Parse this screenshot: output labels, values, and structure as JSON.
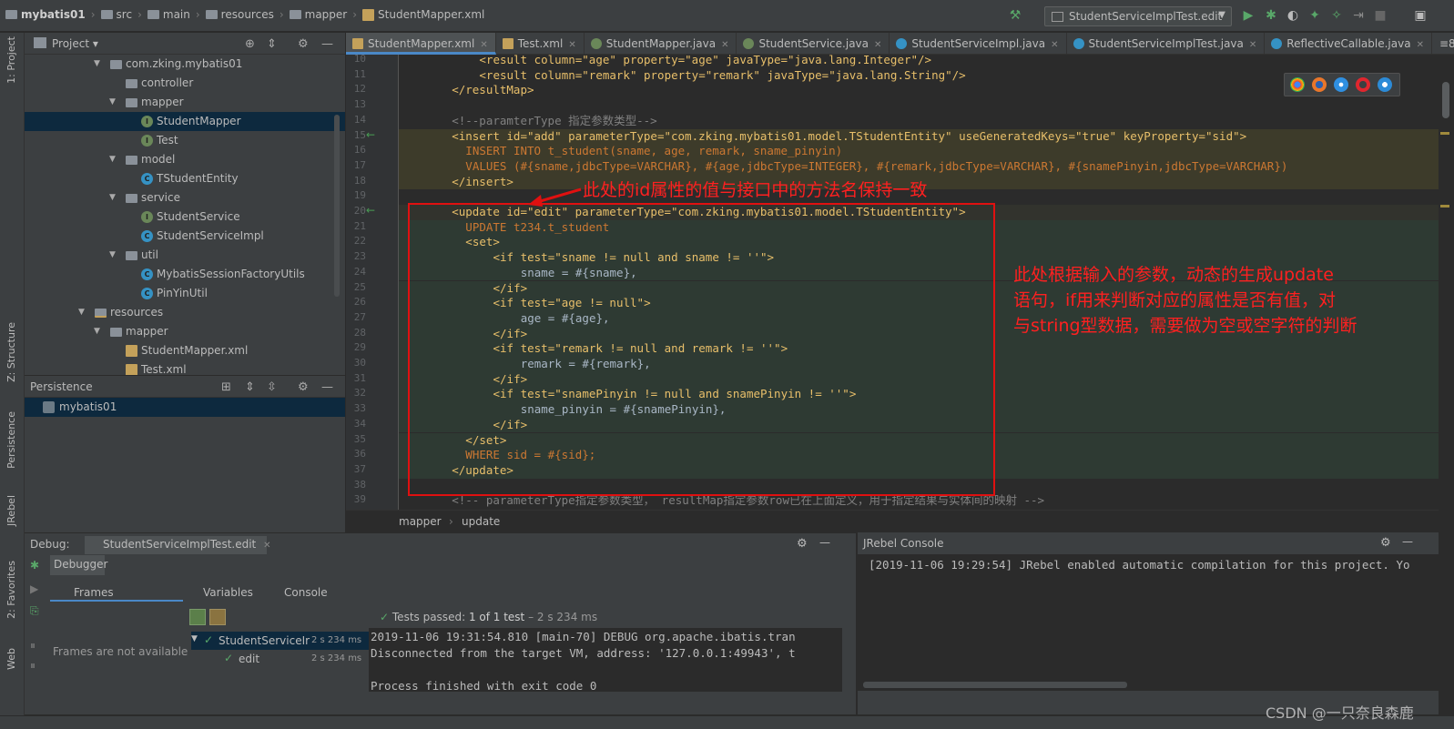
{
  "navbar": {
    "crumbs": [
      "mybatis01",
      "src",
      "main",
      "resources",
      "mapper",
      "StudentMapper.xml"
    ],
    "run_config": "StudentServiceImplTest.edit"
  },
  "left_strip": {
    "tabs": [
      "1: Project",
      "Z: Structure",
      "Persistence",
      "JRebel",
      "2: Favorites",
      "Web"
    ]
  },
  "project_panel": {
    "title": "Project",
    "tree": [
      {
        "label": "com.zking.mybatis01",
        "icon": "folder-icon",
        "depth": 0,
        "arrow": "▼"
      },
      {
        "label": "controller",
        "icon": "folder-icon",
        "depth": 1,
        "arrow": ""
      },
      {
        "label": "mapper",
        "icon": "folder-icon",
        "depth": 1,
        "arrow": "▼"
      },
      {
        "label": "StudentMapper",
        "icon": "interface-icon",
        "depth": 2,
        "arrow": "",
        "selected": true
      },
      {
        "label": "Test",
        "icon": "interface-icon",
        "depth": 2,
        "arrow": ""
      },
      {
        "label": "model",
        "icon": "folder-icon",
        "depth": 1,
        "arrow": "▼"
      },
      {
        "label": "TStudentEntity",
        "icon": "class-icon",
        "depth": 2,
        "arrow": ""
      },
      {
        "label": "service",
        "icon": "folder-icon",
        "depth": 1,
        "arrow": "▼"
      },
      {
        "label": "StudentService",
        "icon": "interface-icon",
        "depth": 2,
        "arrow": ""
      },
      {
        "label": "StudentServiceImpl",
        "icon": "class-icon",
        "depth": 2,
        "arrow": ""
      },
      {
        "label": "util",
        "icon": "folder-icon",
        "depth": 1,
        "arrow": "▼"
      },
      {
        "label": "MybatisSessionFactoryUtils",
        "icon": "class-icon",
        "depth": 2,
        "arrow": ""
      },
      {
        "label": "PinYinUtil",
        "icon": "class-icon",
        "depth": 2,
        "arrow": ""
      },
      {
        "label": "resources",
        "icon": "resources-folder-icon",
        "depth": -1,
        "arrow": "▼"
      },
      {
        "label": "mapper",
        "icon": "folder-icon",
        "depth": 0,
        "arrow": "▼"
      },
      {
        "label": "StudentMapper.xml",
        "icon": "xml-icon",
        "depth": 1,
        "arrow": ""
      },
      {
        "label": "Test.xml",
        "icon": "xml-icon",
        "depth": 1,
        "arrow": ""
      }
    ]
  },
  "persistence_panel": {
    "title": "Persistence",
    "item": "mybatis01"
  },
  "editor": {
    "tabs": [
      {
        "label": "StudentMapper.xml",
        "icon": "xml",
        "active": true
      },
      {
        "label": "Test.xml",
        "icon": "xml",
        "active": false
      },
      {
        "label": "StudentMapper.java",
        "icon": "iface",
        "active": false
      },
      {
        "label": "StudentService.java",
        "icon": "iface",
        "active": false
      },
      {
        "label": "StudentServiceImpl.java",
        "icon": "cls",
        "active": false
      },
      {
        "label": "StudentServiceImplTest.java",
        "icon": "cls",
        "active": false
      },
      {
        "label": "ReflectiveCallable.java",
        "icon": "cls",
        "active": false
      }
    ],
    "overflow": "≡8",
    "lines": [
      {
        "n": "10",
        "indent": 8,
        "text": "<result column=\"age\" property=\"age\" javaType=\"java.lang.Integer\"/>",
        "cls": "tag",
        "hl": ""
      },
      {
        "n": "11",
        "indent": 8,
        "text": "<result column=\"remark\" property=\"remark\" javaType=\"java.lang.String\"/>",
        "cls": "tag",
        "hl": ""
      },
      {
        "n": "12",
        "indent": 4,
        "text": "</resultMap>",
        "cls": "tag",
        "hl": ""
      },
      {
        "n": "13",
        "indent": 0,
        "text": "",
        "cls": "plain",
        "hl": ""
      },
      {
        "n": "14",
        "indent": 4,
        "text": "<!--paramterType 指定参数类型-->",
        "cls": "cmt",
        "hl": ""
      },
      {
        "n": "15",
        "indent": 4,
        "text": "<insert id=\"add\" parameterType=\"com.zking.mybatis01.model.TStudentEntity\" useGeneratedKeys=\"true\" keyProperty=\"sid\">",
        "cls": "tag",
        "hl": "insert",
        "mark": "←"
      },
      {
        "n": "16",
        "indent": 6,
        "text": "INSERT INTO t_student(sname, age, remark, sname_pinyin)",
        "cls": "sqlk",
        "hl": "insert"
      },
      {
        "n": "17",
        "indent": 6,
        "text": "VALUES (#{sname,jdbcType=VARCHAR}, #{age,jdbcType=INTEGER}, #{remark,jdbcType=VARCHAR}, #{snamePinyin,jdbcType=VARCHAR})",
        "cls": "sqlk",
        "hl": "insert"
      },
      {
        "n": "18",
        "indent": 4,
        "text": "</insert>",
        "cls": "tag",
        "hl": "insert"
      },
      {
        "n": "19",
        "indent": 0,
        "text": "",
        "cls": "plain",
        "hl": ""
      },
      {
        "n": "20",
        "indent": 4,
        "text": "<update id=\"edit\" parameterType=\"com.zking.mybatis01.model.TStudentEntity\">",
        "cls": "tag",
        "hl": "current",
        "mark": "←"
      },
      {
        "n": "21",
        "indent": 6,
        "text": "UPDATE t234.t_student",
        "cls": "sqlk",
        "hl": "update"
      },
      {
        "n": "22",
        "indent": 6,
        "text": "<set>",
        "cls": "tag",
        "hl": "update"
      },
      {
        "n": "23",
        "indent": 10,
        "text": "<if test=\"sname != null and sname != ''\">",
        "cls": "tag",
        "hl": "update"
      },
      {
        "n": "24",
        "indent": 14,
        "text": "sname = #{sname},",
        "cls": "plain",
        "hl": "update"
      },
      {
        "n": "25",
        "indent": 10,
        "text": "</if>",
        "cls": "tag",
        "hl": "update"
      },
      {
        "n": "26",
        "indent": 10,
        "text": "<if test=\"age != null\">",
        "cls": "tag",
        "hl": "update"
      },
      {
        "n": "27",
        "indent": 14,
        "text": "age = #{age},",
        "cls": "plain",
        "hl": "update"
      },
      {
        "n": "28",
        "indent": 10,
        "text": "</if>",
        "cls": "tag",
        "hl": "update"
      },
      {
        "n": "29",
        "indent": 10,
        "text": "<if test=\"remark != null and remark != ''\">",
        "cls": "tag",
        "hl": "update"
      },
      {
        "n": "30",
        "indent": 14,
        "text": "remark = #{remark},",
        "cls": "plain",
        "hl": "update"
      },
      {
        "n": "31",
        "indent": 10,
        "text": "</if>",
        "cls": "tag",
        "hl": "update"
      },
      {
        "n": "32",
        "indent": 10,
        "text": "<if test=\"snamePinyin != null and snamePinyin != ''\">",
        "cls": "tag",
        "hl": "update"
      },
      {
        "n": "33",
        "indent": 14,
        "text": "sname_pinyin = #{snamePinyin},",
        "cls": "plain",
        "hl": "update"
      },
      {
        "n": "34",
        "indent": 10,
        "text": "</if>",
        "cls": "tag",
        "hl": "update"
      },
      {
        "n": "35",
        "indent": 6,
        "text": "</set>",
        "cls": "tag",
        "hl": "update"
      },
      {
        "n": "36",
        "indent": 6,
        "text": "WHERE sid = #{sid};",
        "cls": "sqlk",
        "hl": "update"
      },
      {
        "n": "37",
        "indent": 4,
        "text": "</update>",
        "cls": "tag",
        "hl": "update"
      },
      {
        "n": "38",
        "indent": 0,
        "text": "",
        "cls": "plain",
        "hl": ""
      },
      {
        "n": "39",
        "indent": 4,
        "text": "<!-- parameterType指定参数类型， resultMap指定参数row已在上面定义，用于指定结果与实体间的映射 -->",
        "cls": "cmt",
        "hl": ""
      }
    ],
    "breadcrumb": [
      "mapper",
      "update"
    ]
  },
  "annotations": {
    "top": "此处的id属性的值与接口中的方法名保持一致",
    "side": [
      "此处根据输入的参数，动态的生成update",
      "语句，if用来判断对应的属性是否有值，对",
      "与string型数据，需要做为空或空字符的判断"
    ]
  },
  "debug_panel": {
    "title": "Debug:",
    "config_tab": "StudentServiceImplTest.edit",
    "debugger_tab": "Debugger",
    "frames_tab": "Frames",
    "variables_tab": "Variables",
    "console_tab": "Console",
    "frames_empty": "Frames are not available",
    "tests_passed": "Tests passed:",
    "tests_count": "1 of 1 test",
    "tests_time": "– 2 s 234 ms",
    "test_tree": [
      {
        "label": "StudentServiceIr",
        "time": "2 s 234 ms"
      },
      {
        "label": "edit",
        "time": "2 s 234 ms"
      }
    ],
    "console_lines": [
      "2019-11-06 19:31:54.810 [main-70] DEBUG org.apache.ibatis.tran",
      "Disconnected from the target VM, address: '127.0.0.1:49943', t",
      "",
      "Process finished with exit code 0"
    ]
  },
  "jrebel_panel": {
    "title": "JRebel Console",
    "line": "[2019-11-06 19:29:54] JRebel enabled automatic compilation for this project. Yo"
  },
  "watermark": "CSDN @一只奈良森鹿",
  "colors": {
    "annotation": "#e01010",
    "tag": "#e8bf6a",
    "string": "#6a8759",
    "comment": "#808080",
    "sql_keyword": "#cc7832"
  }
}
